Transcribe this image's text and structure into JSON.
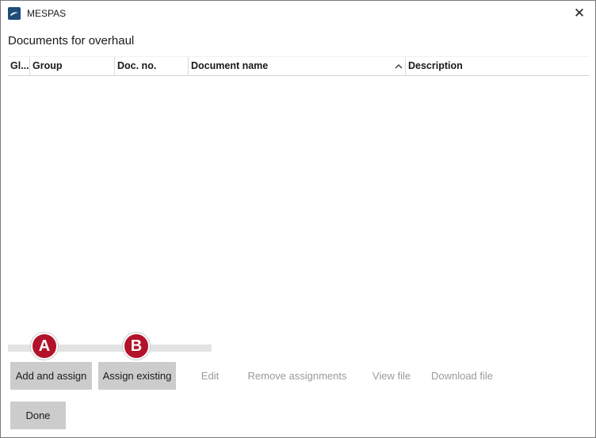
{
  "window": {
    "app_title": "MESPAS",
    "close_glyph": "✕",
    "app_icon": "mespas-logo-icon"
  },
  "page": {
    "title": "Documents for overhaul"
  },
  "table": {
    "columns": [
      "Gl...",
      "Group",
      "Doc. no.",
      "Document name",
      "Description"
    ],
    "sorted_column": "Document name",
    "sort_direction": "ascending",
    "rows": []
  },
  "badges": {
    "a": "A",
    "b": "B",
    "color": "#b3122b"
  },
  "actions": {
    "add_and_assign": "Add and assign",
    "assign_existing": "Assign existing",
    "edit": "Edit",
    "remove_assignments": "Remove assignments",
    "view_file": "View file",
    "download_file": "Download file",
    "done": "Done"
  }
}
